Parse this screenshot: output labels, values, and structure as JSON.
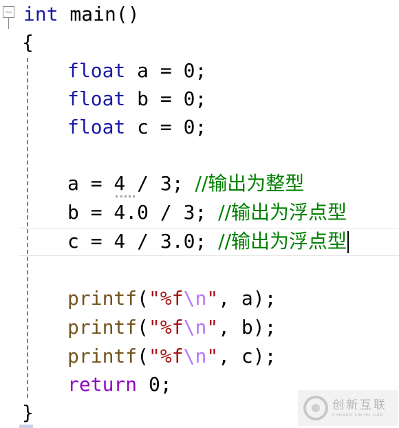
{
  "editor": {
    "lines": [
      {
        "parts": [
          {
            "k": "type",
            "t": "int"
          },
          {
            "k": "plain",
            "t": " main()"
          }
        ]
      },
      {
        "parts": [
          {
            "k": "plain",
            "t": "{"
          }
        ]
      },
      {
        "parts": [
          {
            "k": "type",
            "t": "float"
          },
          {
            "k": "plain",
            "t": " a = 0;"
          }
        ]
      },
      {
        "parts": [
          {
            "k": "type",
            "t": "float"
          },
          {
            "k": "plain",
            "t": " b = 0;"
          }
        ]
      },
      {
        "parts": [
          {
            "k": "type",
            "t": "float"
          },
          {
            "k": "plain",
            "t": " c = 0;"
          }
        ]
      },
      {
        "parts": []
      },
      {
        "parts": [
          {
            "k": "plain",
            "t": "a = 4 / 3; "
          },
          {
            "k": "cmt",
            "t": "//输出为整型"
          }
        ]
      },
      {
        "parts": [
          {
            "k": "plain",
            "t": "b = 4.0 / 3; "
          },
          {
            "k": "cmt",
            "t": "//输出为浮点型"
          }
        ]
      },
      {
        "parts": [
          {
            "k": "plain",
            "t": "c = 4 / 3.0; "
          },
          {
            "k": "cmt",
            "t": "//输出为浮点型"
          }
        ]
      },
      {
        "parts": []
      },
      {
        "parts": [
          {
            "k": "fn",
            "t": "printf"
          },
          {
            "k": "plain",
            "t": "("
          },
          {
            "k": "str",
            "t": "\"%f"
          },
          {
            "k": "esc",
            "t": "\\n"
          },
          {
            "k": "str",
            "t": "\""
          },
          {
            "k": "plain",
            "t": ", a);"
          }
        ]
      },
      {
        "parts": [
          {
            "k": "fn",
            "t": "printf"
          },
          {
            "k": "plain",
            "t": "("
          },
          {
            "k": "str",
            "t": "\"%f"
          },
          {
            "k": "esc",
            "t": "\\n"
          },
          {
            "k": "str",
            "t": "\""
          },
          {
            "k": "plain",
            "t": ", b);"
          }
        ]
      },
      {
        "parts": [
          {
            "k": "fn",
            "t": "printf"
          },
          {
            "k": "plain",
            "t": "("
          },
          {
            "k": "str",
            "t": "\"%f"
          },
          {
            "k": "esc",
            "t": "\\n"
          },
          {
            "k": "str",
            "t": "\""
          },
          {
            "k": "plain",
            "t": ", c);"
          }
        ]
      },
      {
        "parts": [
          {
            "k": "ctrl",
            "t": "return"
          },
          {
            "k": "plain",
            "t": " 0;"
          }
        ]
      },
      {
        "parts": [
          {
            "k": "plain",
            "t": "}"
          }
        ]
      }
    ],
    "caret_line": 9
  },
  "watermark": {
    "cn": "创新互联",
    "en": "CHUANG XIN HU LIAN",
    "icon": "logo-icon"
  },
  "colors": {
    "type_keyword": "#1a1aa6",
    "control_keyword": "#8f08c4",
    "function": "#74531f",
    "string": "#a31515",
    "escape": "#b776fb",
    "comment": "#008000"
  }
}
